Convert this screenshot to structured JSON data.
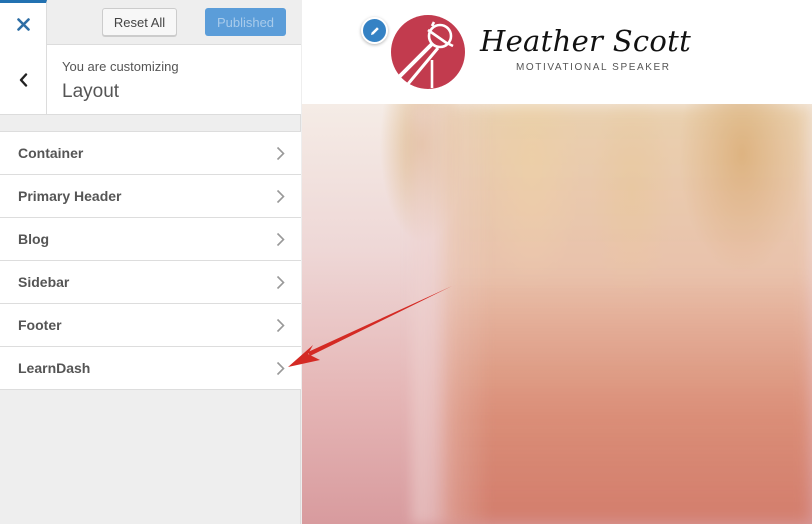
{
  "sidebar": {
    "close_icon": "close-x-icon",
    "reset_label": "Reset All",
    "publish_label": "Published",
    "back_icon": "chevron-left-icon",
    "customizing_label": "You are customizing",
    "section_title": "Layout",
    "items": [
      {
        "label": "Container",
        "icon": "chevron-right-icon"
      },
      {
        "label": "Primary Header",
        "icon": "chevron-right-icon"
      },
      {
        "label": "Blog",
        "icon": "chevron-right-icon"
      },
      {
        "label": "Sidebar",
        "icon": "chevron-right-icon"
      },
      {
        "label": "Footer",
        "icon": "chevron-right-icon"
      },
      {
        "label": "LearnDash",
        "icon": "chevron-right-icon"
      }
    ]
  },
  "preview": {
    "edit_icon": "pencil-icon",
    "site_title": "Heather Scott",
    "site_tagline": "MOTIVATIONAL SPEAKER",
    "logo_icon": "microphone-logo-icon"
  },
  "annotation": {
    "arrow_target": "LearnDash",
    "arrow_color": "#d42a24"
  },
  "colors": {
    "accent": "#2271b1",
    "publish_bg": "#5b9dd9",
    "logo_red": "#c23b4e"
  }
}
